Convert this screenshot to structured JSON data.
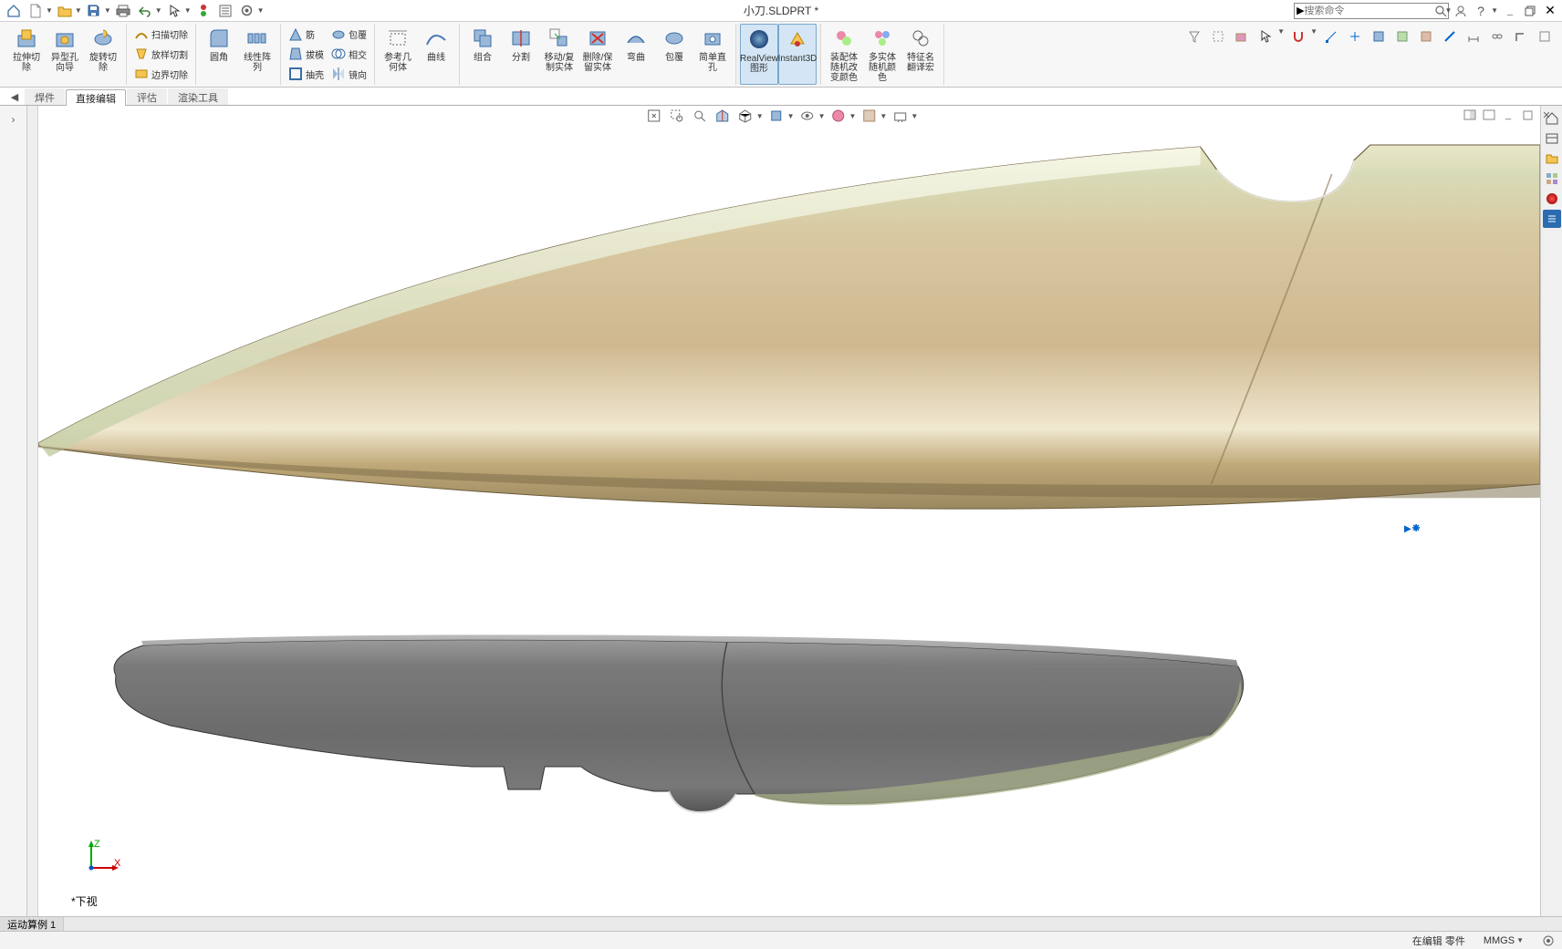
{
  "title": "小刀.SLDPRT *",
  "search_placeholder": "搜索命令",
  "ribbon": {
    "g1": {
      "extrude_cut": "拉伸切\n除",
      "hole_wizard": "异型孔\n向导",
      "revolve_cut": "旋转切\n除"
    },
    "g2": {
      "sweep_cut": "扫描切除",
      "loft_cut": "放样切割",
      "boundary_cut": "边界切除"
    },
    "g3": {
      "fillet": "圆角",
      "linear_pattern": "线性阵\n列"
    },
    "g4": {
      "rib": "筋",
      "draft": "拔模",
      "shell": "抽壳",
      "wrap": "包覆",
      "intersect": "相交",
      "mirror": "镜向"
    },
    "g5": {
      "ref_geom": "参考几\n何体",
      "curves": "曲线"
    },
    "g6": {
      "combine": "组合",
      "split": "分割",
      "move_copy": "移动/复\n制实体",
      "delete_keep": "删除/保\n留实体",
      "flex": "弯曲",
      "wrap2": "包覆",
      "single_hole": "简单直\n孔"
    },
    "g7": {
      "realview": "RealView\n图形",
      "instant3d": "Instant3D"
    },
    "g8": {
      "asm_color": "装配体\n随机改\n变颜色",
      "multi_color": "多实体\n随机颜\n色",
      "feature_name": "特征名\n翻译宏"
    }
  },
  "tabs": [
    "焊件",
    "直接编辑",
    "评估",
    "渲染工具"
  ],
  "bottom_tab": "运动算例 1",
  "view_name": "*下视",
  "status": {
    "edit": "在编辑 零件",
    "units": "MMGS"
  },
  "rightbar_items": [
    "home",
    "layers",
    "folder",
    "appearance",
    "color",
    "display"
  ]
}
